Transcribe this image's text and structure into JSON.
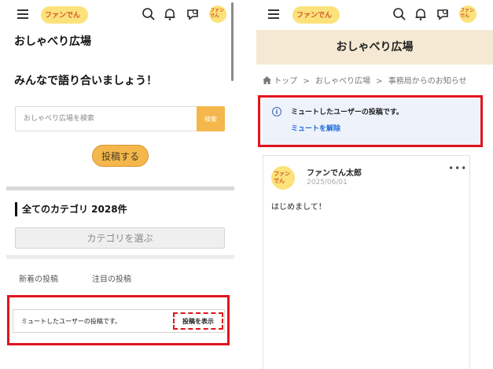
{
  "header": {
    "logo_text": "ファンでん",
    "avatar_text": "ファンでん"
  },
  "left": {
    "title": "おしゃべり広場",
    "subtitle": "みんなで語り合いましょう！",
    "search": {
      "placeholder": "おしゃべり広場を検索",
      "button": "検索"
    },
    "post_button": "投稿する",
    "category_heading": "全てのカテゴリ 2028件",
    "category_select": "カテゴリを選ぶ",
    "tabs": [
      "新着の投稿",
      "注目の投稿"
    ],
    "muted_notice": "ミュートしたユーザーの投稿です。",
    "show_post_button": "投稿を表示"
  },
  "right": {
    "page_title": "おしゃべり広場",
    "breadcrumb": [
      "トップ",
      ">",
      "おしゃべり広場",
      ">",
      "事務局からのお知らせ"
    ],
    "notice": {
      "text": "ミュートしたユーザーの投稿です。",
      "action": "ミュートを解除",
      "icon": "i"
    },
    "post": {
      "author": "ファンでん太郎",
      "date": "2025/06/01",
      "body": "はじめまして！",
      "more": "•••",
      "avatar_text": "ファンでん"
    }
  },
  "colors": {
    "accent": "#f3b74b",
    "highlight": "#e0141e",
    "link": "#1c6ad8",
    "page_head": "#f6e9d3"
  }
}
